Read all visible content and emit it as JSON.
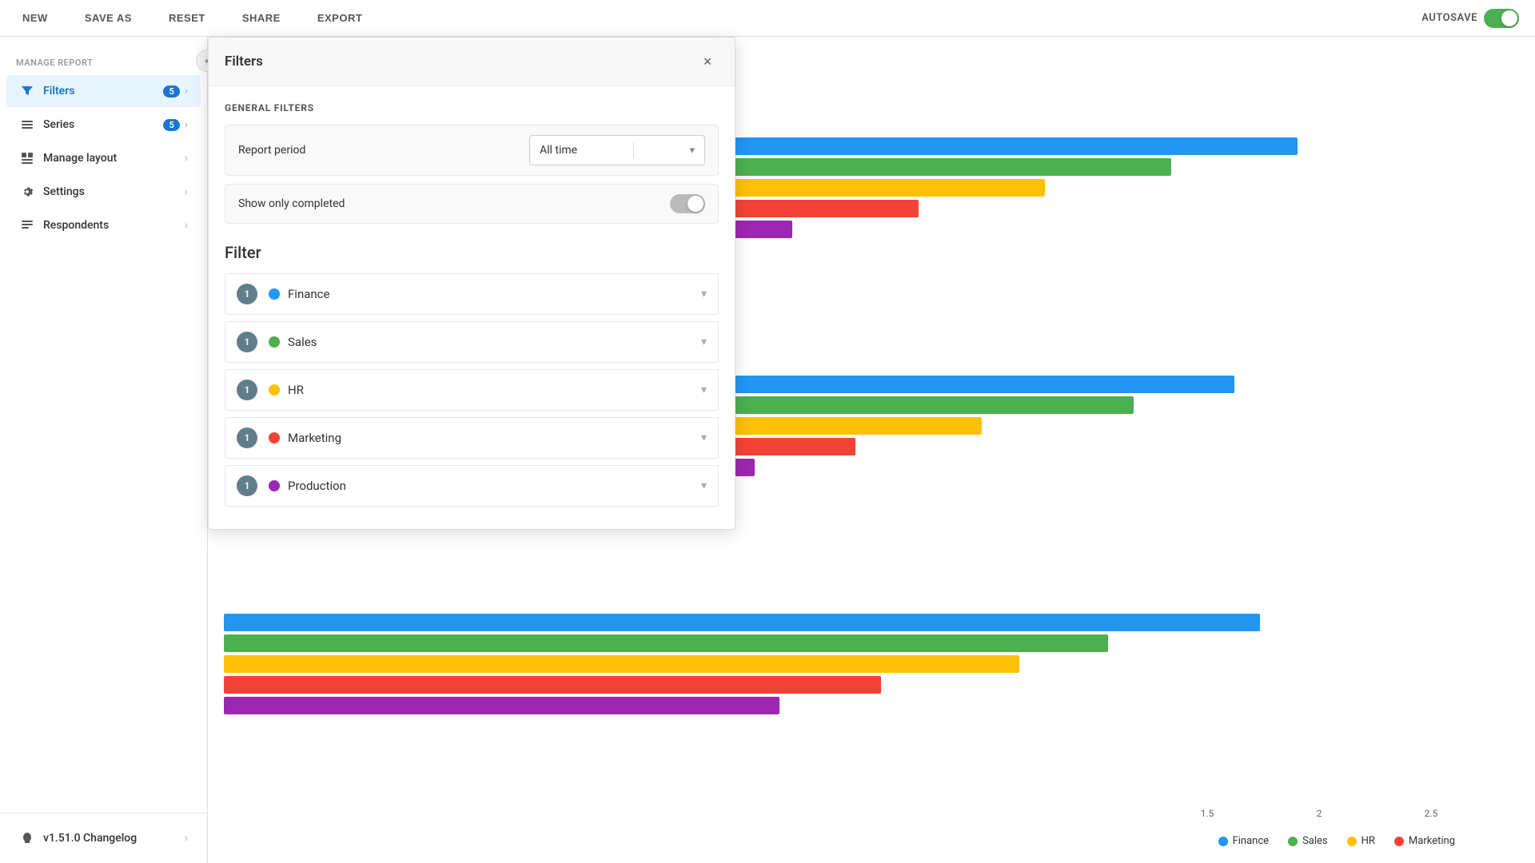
{
  "toolbar": {
    "buttons": [
      "NEW",
      "SAVE AS",
      "RESET",
      "SHARE",
      "EXPORT"
    ],
    "autosave_label": "AUTOSAVE",
    "autosave_on": true
  },
  "sidebar": {
    "manage_report_label": "MANAGE REPORT",
    "collapse_icon": "«",
    "items": [
      {
        "id": "filters",
        "label": "Filters",
        "badge": 5,
        "icon": "filter",
        "active": true
      },
      {
        "id": "series",
        "label": "Series",
        "badge": 5,
        "icon": "series"
      },
      {
        "id": "manage-layout",
        "label": "Manage layout",
        "icon": "layout"
      },
      {
        "id": "settings",
        "label": "Settings",
        "icon": "settings"
      },
      {
        "id": "respondents",
        "label": "Respondents",
        "icon": "respondents"
      }
    ],
    "bottom": {
      "version_label": "v1.51.0 Changelog"
    }
  },
  "filter_panel": {
    "title": "Filters",
    "close_btn": "×",
    "general_filters_label": "GENERAL FILTERS",
    "report_period_label": "Report period",
    "report_period_value": "All time",
    "show_only_completed_label": "Show only completed",
    "filter_section_title": "Filter",
    "filter_items": [
      {
        "id": "finance",
        "badge": 1,
        "label": "Finance",
        "color": "#2196f3"
      },
      {
        "id": "sales",
        "badge": 1,
        "label": "Sales",
        "color": "#4caf50"
      },
      {
        "id": "hr",
        "badge": 1,
        "label": "HR",
        "color": "#ffc107"
      },
      {
        "id": "marketing",
        "badge": 1,
        "label": "Marketing",
        "color": "#f44336"
      },
      {
        "id": "production",
        "badge": 1,
        "label": "Production",
        "color": "#9c27b0"
      }
    ]
  },
  "chart": {
    "x_labels": [
      "1.5",
      "2",
      "2.5"
    ],
    "legend": [
      {
        "label": "Finance",
        "color": "#2196f3"
      },
      {
        "label": "Sales",
        "color": "#4caf50"
      },
      {
        "label": "HR",
        "color": "#ffc107"
      },
      {
        "label": "Marketing",
        "color": "#f44336"
      }
    ],
    "bar_groups": [
      {
        "bars": [
          {
            "color": "#2196f3",
            "width": "85%"
          },
          {
            "color": "#4caf50",
            "width": "75%"
          },
          {
            "color": "#ffc107",
            "width": "65%"
          },
          {
            "color": "#f44336",
            "width": "55%"
          },
          {
            "color": "#9c27b0",
            "width": "45%"
          }
        ]
      },
      {
        "bars": [
          {
            "color": "#2196f3",
            "width": "80%"
          },
          {
            "color": "#4caf50",
            "width": "72%"
          },
          {
            "color": "#ffc107",
            "width": "60%"
          },
          {
            "color": "#f44336",
            "width": "50%"
          },
          {
            "color": "#9c27b0",
            "width": "42%"
          }
        ]
      },
      {
        "bars": [
          {
            "color": "#2196f3",
            "width": "82%"
          },
          {
            "color": "#4caf50",
            "width": "70%"
          },
          {
            "color": "#ffc107",
            "width": "63%"
          },
          {
            "color": "#f44336",
            "width": "52%"
          },
          {
            "color": "#9c27b0",
            "width": "44%"
          }
        ]
      }
    ]
  }
}
